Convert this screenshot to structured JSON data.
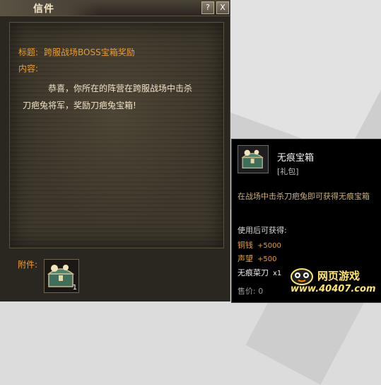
{
  "window": {
    "title": "信件",
    "help_label": "?",
    "close_label": "X"
  },
  "mail": {
    "subject_label": "标题:",
    "subject_value": "跨服战场BOSS宝箱奖励",
    "content_label": "内容:",
    "content_line1": "恭喜，你所在的阵营在跨服战场中击杀",
    "content_line2": "刀疤兔将军，奖励刀疤兔宝箱!",
    "attachment_label": "附件:",
    "attachment_count": "1",
    "attachment_icon": "treasure-chest-icon"
  },
  "tooltip": {
    "item_name": "无痕宝箱",
    "item_type": "[礼包]",
    "description": "在战场中击杀刀疤兔即可获得无痕宝箱",
    "use_label": "使用后可获得:",
    "rewards": [
      {
        "name": "铜钱",
        "amount": "+5000"
      },
      {
        "name": "声望",
        "amount": "+500"
      },
      {
        "name": "无痕菜刀",
        "amount": "x1"
      }
    ],
    "price": "售价: 0",
    "icon": "treasure-chest-icon"
  },
  "watermark": {
    "title": "网页游戏",
    "url": "www.40407.com"
  }
}
